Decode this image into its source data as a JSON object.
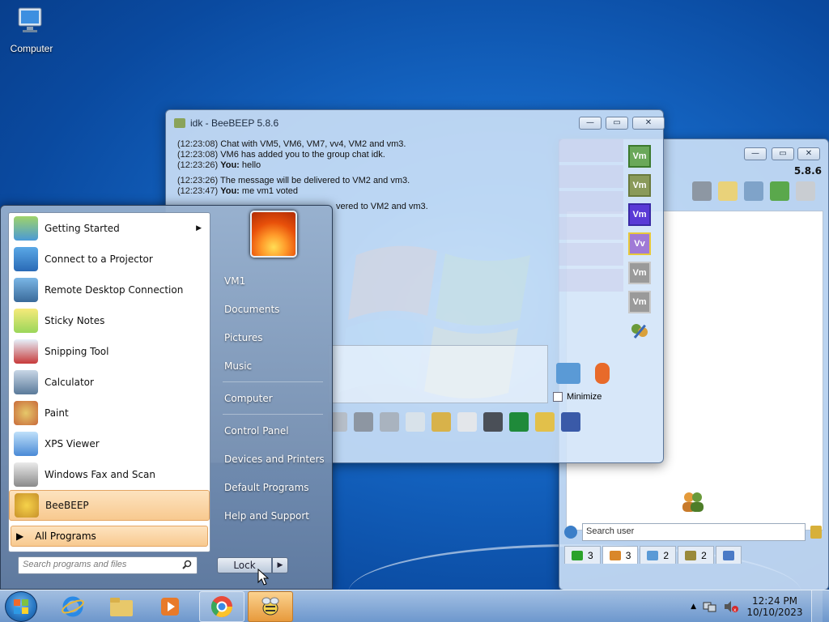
{
  "desktop": {
    "computer_icon_label": "Computer"
  },
  "contact_window": {
    "version": "5.8.6",
    "search_placeholder": "Search user",
    "tabs": [
      {
        "count": "3",
        "icon": "green-chat-icon"
      },
      {
        "count": "3",
        "icon": "users-icon"
      },
      {
        "count": "2",
        "icon": "chats-icon"
      },
      {
        "count": "2",
        "icon": "groups-icon"
      },
      {
        "count": "",
        "icon": "share-icon"
      }
    ]
  },
  "chat_window": {
    "title": "idk - BeeBEEP 5.8.6",
    "minimize_label": "Minimize",
    "members": [
      "Vm",
      "Vm",
      "Vm",
      "Vv",
      "Vm",
      "Vm"
    ],
    "lines": [
      {
        "time": "(12:23:08)",
        "text": "Chat with VM5, VM6, VM7, vv4, VM2 and vm3."
      },
      {
        "time": "(12:23:08)",
        "text": "VM6 has added you to the group chat idk."
      },
      {
        "time": "(12:23:26)",
        "who": "You:",
        "text": "hello"
      },
      {
        "time": "(12:23:26)",
        "text": "The message will be delivered to VM2 and vm3."
      },
      {
        "time": "(12:23:47)",
        "who": "You:",
        "text": "me vm1 voted"
      },
      {
        "time": "",
        "text": "vered to VM2 and vm3."
      }
    ]
  },
  "start_menu": {
    "programs": [
      {
        "label": "Getting Started",
        "has_submenu": true
      },
      {
        "label": "Connect to a Projector"
      },
      {
        "label": "Remote Desktop Connection"
      },
      {
        "label": "Sticky Notes"
      },
      {
        "label": "Snipping Tool"
      },
      {
        "label": "Calculator"
      },
      {
        "label": "Paint"
      },
      {
        "label": "XPS Viewer"
      },
      {
        "label": "Windows Fax and Scan"
      },
      {
        "label": "BeeBEEP"
      }
    ],
    "all_programs": "All Programs",
    "search_placeholder": "Search programs and files",
    "right_links": [
      "VM1",
      "Documents",
      "Pictures",
      "Music",
      "Computer",
      "Control Panel",
      "Devices and Printers",
      "Default Programs",
      "Help and Support"
    ],
    "lock_label": "Lock"
  },
  "taskbar": {
    "time": "12:24 PM",
    "date": "10/10/2023"
  }
}
